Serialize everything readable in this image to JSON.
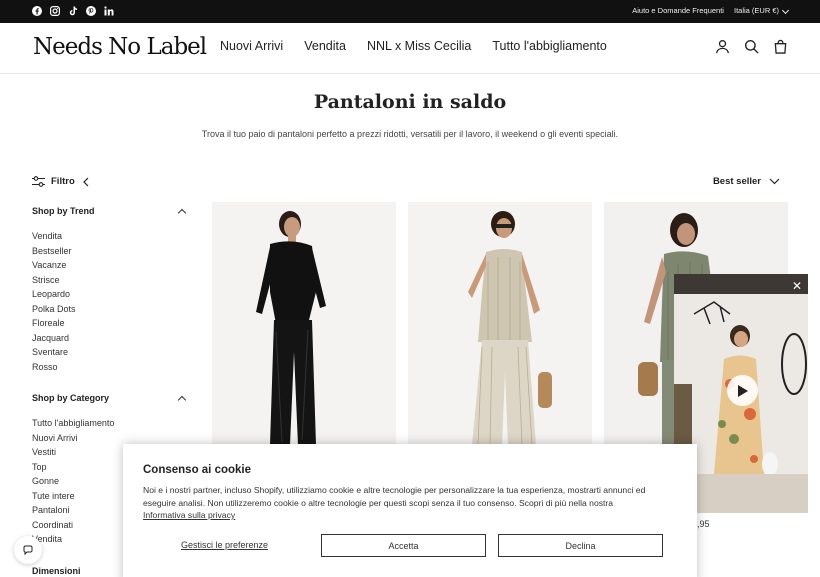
{
  "topbar": {
    "socials": [
      "facebook-icon",
      "instagram-icon",
      "tiktok-icon",
      "pinterest-icon",
      "linkedin-icon"
    ],
    "help_link": "Aiuto e Domande Frequenti",
    "region": "Italia (EUR €)"
  },
  "header": {
    "logo": "Needs No Label",
    "nav": [
      "Nuovi Arrivi",
      "Vendita",
      "NNL x Miss Cecilia",
      "Tutto l'abbigliamento"
    ],
    "icons": [
      "account-icon",
      "search-icon",
      "cart-icon"
    ]
  },
  "page": {
    "title": "Pantaloni in saldo",
    "subtitle": "Trova il tuo paio di pantaloni perfetto a prezzi ridotti, versatili per il lavoro, il weekend o gli eventi speciali."
  },
  "filter": {
    "label": "Filtro",
    "sort_label": "Best seller"
  },
  "sidebar": {
    "trend": {
      "title": "Shop by Trend",
      "items": [
        "Vendita",
        "Bestseller",
        "Vacanze",
        "Strisce",
        "Leopardo",
        "Polka Dots",
        "Floreale",
        "Jacquard",
        "Sventare",
        "Rosso"
      ]
    },
    "category": {
      "title": "Shop by Category",
      "items": [
        "Tutto l'abbigliamento",
        "Nuovi Arrivi",
        "Vestiti",
        "Top",
        "Gonne",
        "Tute intere",
        "Pantaloni",
        "Coordinati",
        "Vendita"
      ]
    },
    "dimensions": {
      "title": "Dimensioni"
    }
  },
  "products": [
    {
      "name": "product-black-sequin-trousers"
    },
    {
      "name": "product-striped-linen-set"
    },
    {
      "name": "product-green-pleated-set"
    }
  ],
  "price_fragment": ",95",
  "video": {
    "close": "✕"
  },
  "cookie": {
    "title": "Consenso ai cookie",
    "text": "Noi e i nostri partner, incluso Shopify, utilizziamo cookie e altre tecnologie per personalizzare la tua esperienza, mostrarti annunci ed eseguire analisi. Non utilizzeremo cookie o altre tecnologie per questi scopi senza il tuo consenso. Scopri di più nella nostra",
    "privacy_link": "Informativa sulla privacy",
    "manage": "Gestisci le preferenze",
    "accept": "Accetta",
    "decline": "Declina"
  }
}
